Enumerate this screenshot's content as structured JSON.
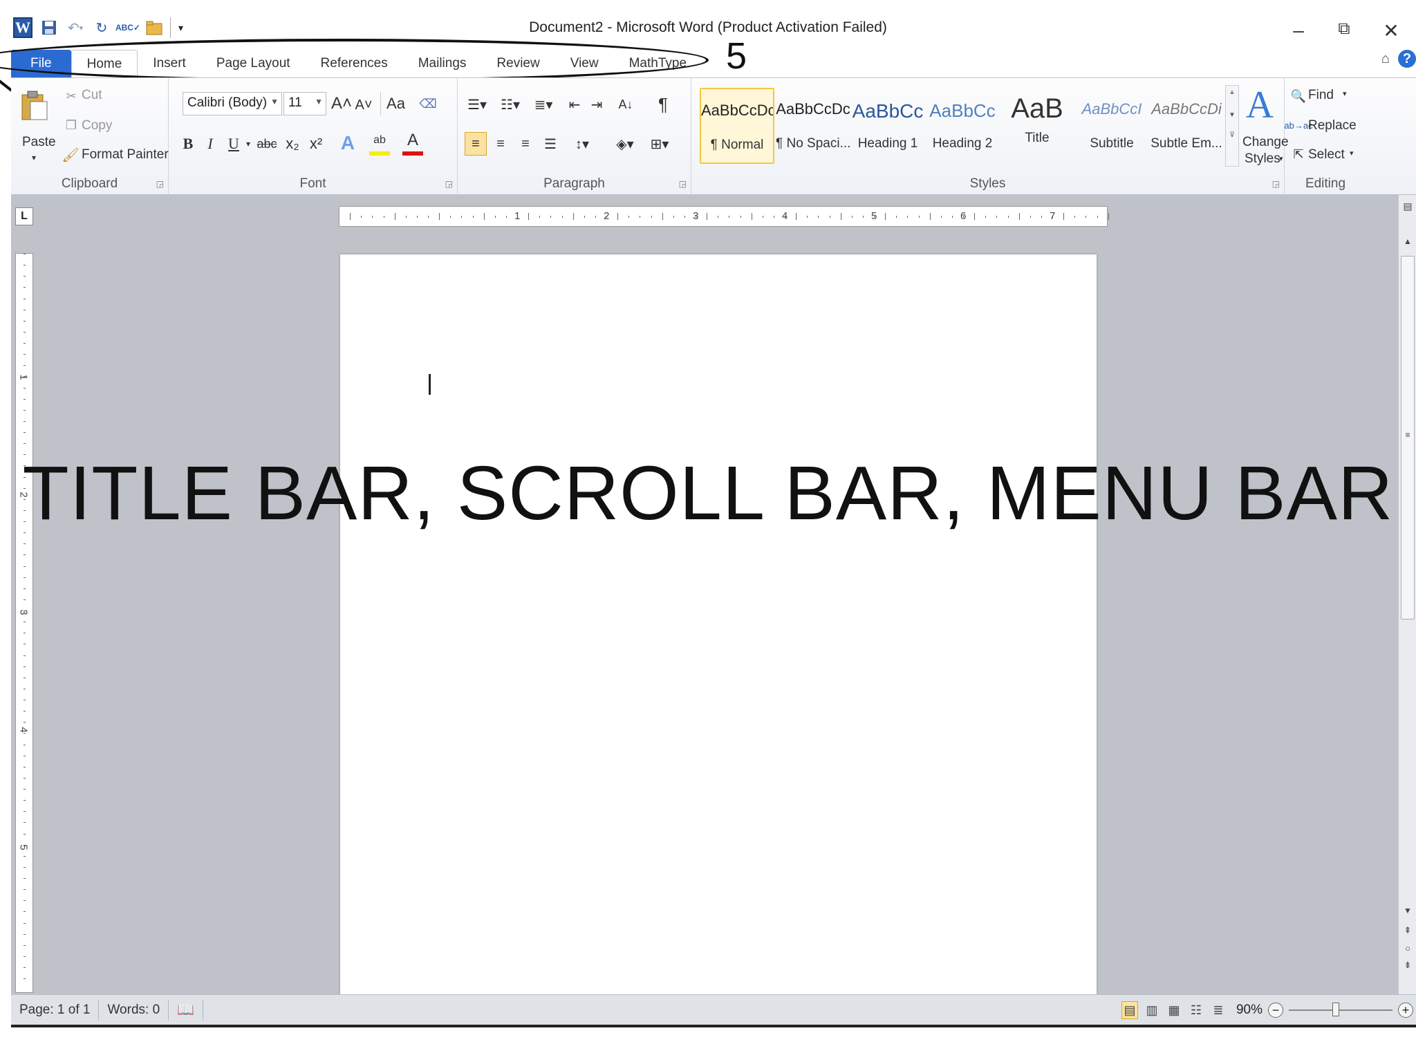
{
  "titlebar": {
    "document_title": "Document2 - Microsoft Word (Product Activation Failed)",
    "app_icon": "word-logo",
    "qat_icons": [
      "save-icon",
      "undo-icon",
      "redo-icon",
      "spelling-icon",
      "open-icon",
      "customize-qat-icon"
    ],
    "minimize": "–",
    "restore": "⧉",
    "close": "✕"
  },
  "tabs": [
    "File",
    "Home",
    "Insert",
    "Page Layout",
    "References",
    "Mailings",
    "Review",
    "View",
    "MathType"
  ],
  "annotation": {
    "number": "5"
  },
  "ribbon": {
    "clipboard": {
      "paste": "Paste",
      "cut": "Cut",
      "copy": "Copy",
      "format_painter": "Format Painter",
      "label": "Clipboard"
    },
    "font": {
      "font_name": "Calibri (Body)",
      "font_size": "11",
      "label": "Font",
      "bold": "B",
      "italic": "I",
      "underline": "U",
      "strike": "abc",
      "sub": "x₂",
      "sup": "x²",
      "grow": "A˄",
      "shrink": "A˅",
      "case": "Aa",
      "font_color": "A",
      "highlight": "ab",
      "text_effects": "A"
    },
    "paragraph": {
      "label": "Paragraph",
      "pilcrow": "¶"
    },
    "styles": {
      "label": "Styles",
      "items": [
        {
          "sample": "AaBbCcDc",
          "name": "¶ Normal"
        },
        {
          "sample": "AaBbCcDc",
          "name": "¶ No Spaci..."
        },
        {
          "sample": "AaBbCc",
          "name": "Heading 1"
        },
        {
          "sample": "AaBbCc",
          "name": "Heading 2"
        },
        {
          "sample": "AaB",
          "name": "Title"
        },
        {
          "sample": "AaBbCcI",
          "name": "Subtitle"
        },
        {
          "sample": "AaBbCcDi",
          "name": "Subtle Em..."
        }
      ],
      "change_styles_1": "Change",
      "change_styles_2": "Styles"
    },
    "editing": {
      "label": "Editing",
      "find": "Find",
      "replace": "Replace",
      "select": "Select"
    }
  },
  "ruler": {
    "numbers": [
      "1",
      "2",
      "3",
      "4",
      "5",
      "6",
      "7"
    ],
    "vnumbers": [
      "1",
      "2",
      "3",
      "4",
      "5"
    ]
  },
  "overlay_text": "TITLE BAR, SCROLL BAR, MENU BAR",
  "status": {
    "page": "Page: 1 of 1",
    "words": "Words: 0",
    "zoom": "90%",
    "zoom_level": 0.45
  },
  "colors": {
    "file_tab": "#2b6ad1",
    "accent_blue": "#2a5ba8",
    "selected_style": "#f5c542"
  }
}
